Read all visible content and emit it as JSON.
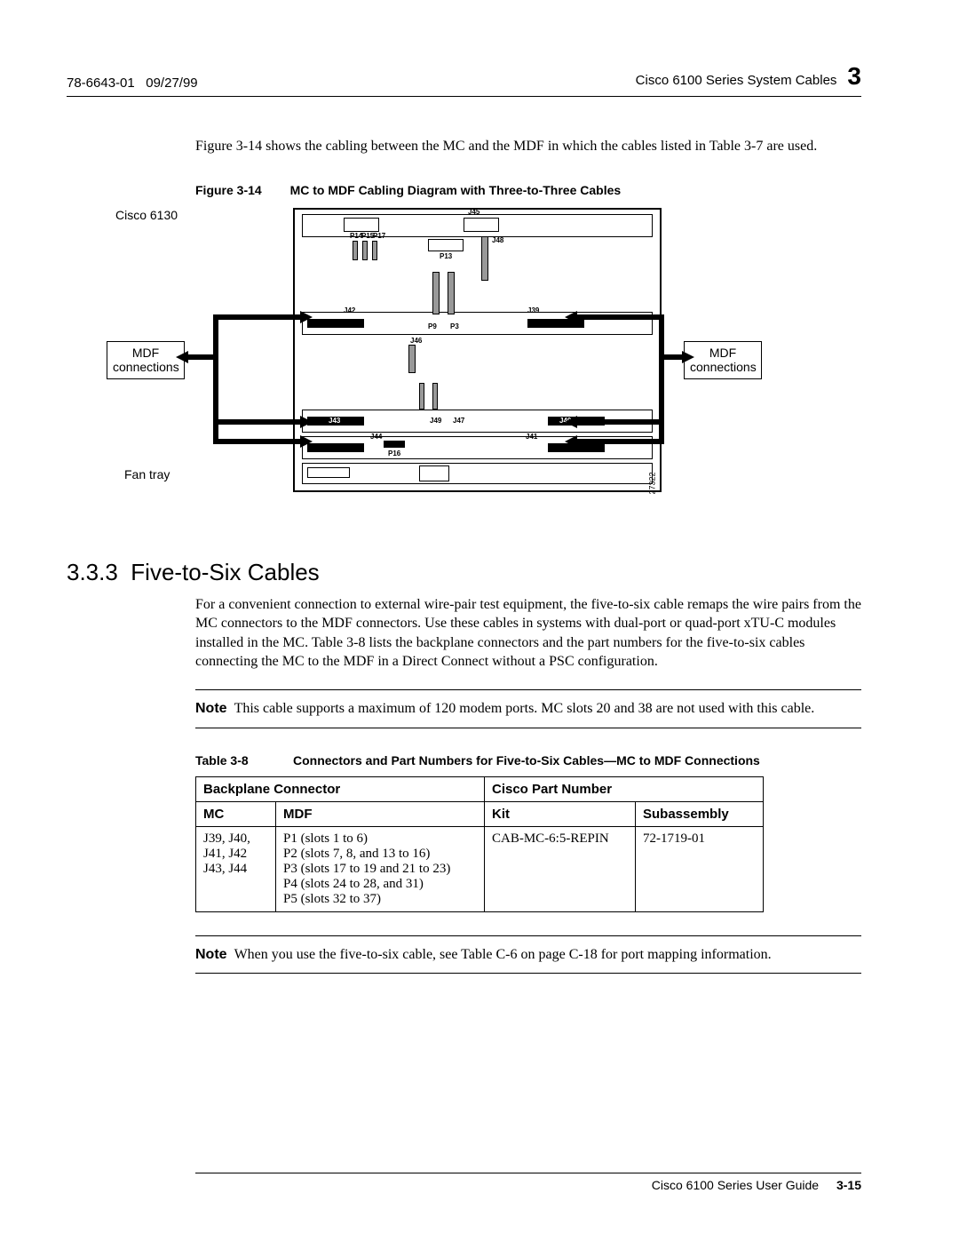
{
  "header": {
    "doc_id": "78-6643-01",
    "date": "09/27/99",
    "title": "Cisco 6100 Series System Cables",
    "chapter_num": "3"
  },
  "intro": "Figure 3-14 shows the cabling between the MC and the MDF in which the cables listed in Table 3-7 are used.",
  "figure": {
    "label": "Figure 3-14",
    "title": "MC to MDF Cabling Diagram with Three-to-Three Cables",
    "device_label": "Cisco 6130",
    "mdf_left": "MDF\nconnections",
    "mdf_right": "MDF\nconnections",
    "fan_tray": "Fan tray",
    "j42": "J42",
    "j39": "J39",
    "j43": "J43",
    "j40": "J40",
    "j44": "J44",
    "j41": "J41",
    "j45": "J45",
    "j46": "J46",
    "j47": "J47",
    "j48": "J48",
    "j49": "J49",
    "p3": "P3",
    "p9": "P9",
    "p13": "P13",
    "p14": "P14",
    "p15": "P15",
    "p16": "P16",
    "p17": "P17",
    "fig_id": "27322"
  },
  "section": {
    "number": "3.3.3",
    "title": "Five-to-Six Cables",
    "para": "For a convenient connection to external wire-pair test equipment, the five-to-six cable remaps the wire pairs from the MC connectors to the MDF connectors. Use these cables in systems with dual-port or quad-port xTU-C modules installed in the MC. Table 3-8 lists the backplane connectors and the part numbers for the five-to-six cables connecting the MC to the MDF in a Direct Connect without a PSC configuration."
  },
  "note1": "This cable supports a maximum of 120 modem ports. MC slots 20 and 38 are not used with this cable.",
  "table": {
    "label": "Table 3-8",
    "title": "Connectors and Part Numbers for Five-to-Six Cables—MC to MDF Connections",
    "head_backplane": "Backplane Connector",
    "head_partnum": "Cisco Part Number",
    "head_mc": "MC",
    "head_mdf": "MDF",
    "head_kit": "Kit",
    "head_sub": "Subassembly",
    "row": {
      "mc": "J39, J40, J41, J42 J43, J44",
      "mdf": "P1 (slots 1 to 6)\nP2 (slots 7, 8, and 13 to 16)\nP3 (slots 17 to 19 and 21 to 23)\nP4 (slots 24 to 28, and 31)\nP5 (slots 32 to 37)",
      "kit": "CAB-MC-6:5-REPIN",
      "sub": "72-1719-01"
    }
  },
  "note2": "When you use the five-to-six cable, see Table C-6 on page C-18 for port mapping information.",
  "footer": {
    "guide": "Cisco 6100 Series User Guide",
    "page": "3-15"
  },
  "note_label": "Note"
}
